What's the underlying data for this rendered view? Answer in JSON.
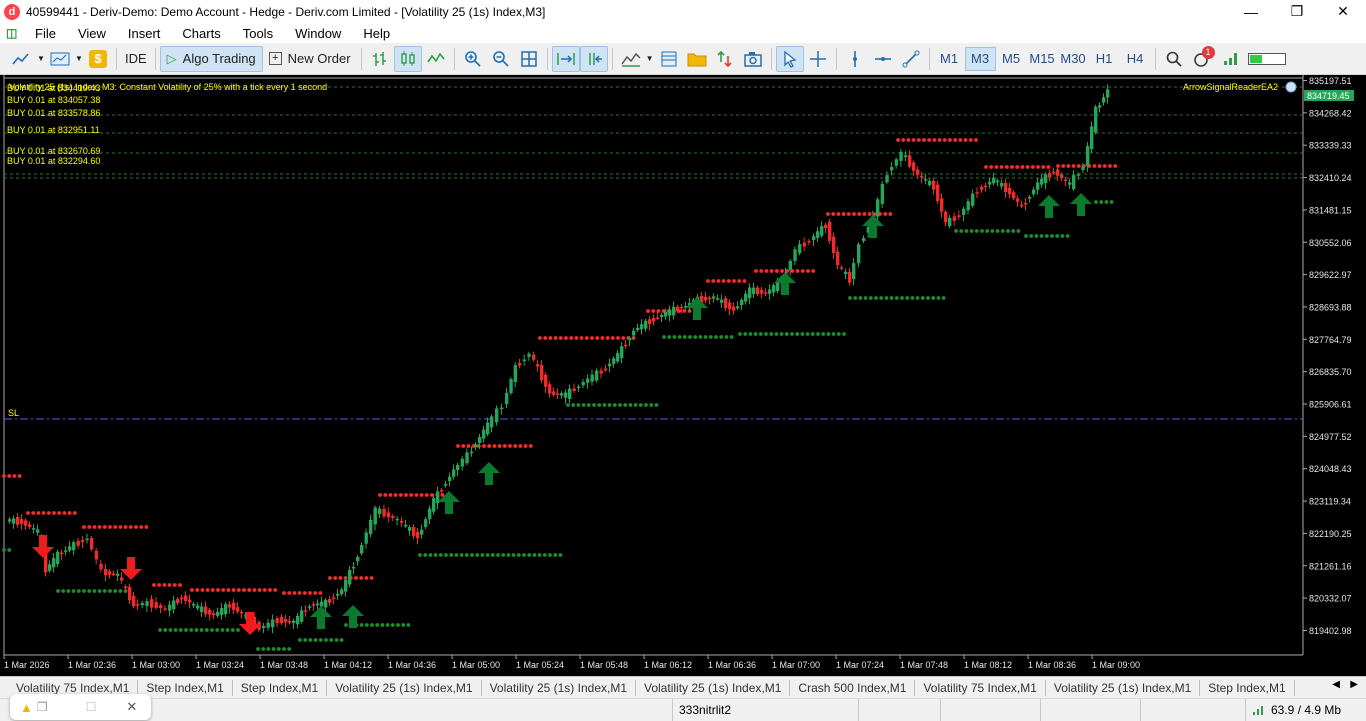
{
  "window": {
    "title": "40599441 - Deriv-Demo: Demo Account - Hedge - Deriv.com Limited - [Volatility 25 (1s) Index,M3]",
    "app_icon": "d",
    "minimize": "—",
    "restore": "❐",
    "close": "✕"
  },
  "menu": {
    "items": [
      "File",
      "View",
      "Insert",
      "Charts",
      "Tools",
      "Window",
      "Help"
    ]
  },
  "toolbar": {
    "ide": "IDE",
    "algo_trading": "Algo Trading",
    "new_order": "New Order",
    "timeframes": [
      "M1",
      "M3",
      "M5",
      "M15",
      "M30",
      "H1",
      "H4"
    ],
    "active_timeframe": "M3",
    "notifications_count": "1"
  },
  "chart": {
    "header": "Volatility 25 (1s) Index, M3:  Constant Volatility of 25% with a tick every 1 second",
    "indicator": "ArrowSignalReaderEA2",
    "bid_price": "834719.45",
    "sl_label": "SL",
    "buy_orders": [
      "BUY 0.01 at 834419.43",
      "BUY 0.01 at 834057.38",
      "BUY 0.01 at 833578.86",
      "BUY 0.01 at 832951.11",
      "BUY 0.01 at 832670.69",
      "BUY 0.01 at 832294.60"
    ],
    "price_axis": [
      "835197.51",
      "834268.42",
      "833339.33",
      "832410.24",
      "831481.15",
      "830552.06",
      "829622.97",
      "828693.88",
      "827764.79",
      "826835.70",
      "825906.61",
      "824977.52",
      "824048.43",
      "823119.34",
      "822190.25",
      "821261.16",
      "820332.07",
      "819402.98"
    ],
    "time_axis": [
      "1 Mar 2026",
      "1 Mar 02:36",
      "1 Mar 03:00",
      "1 Mar 03:24",
      "1 Mar 03:48",
      "1 Mar 04:12",
      "1 Mar 04:36",
      "1 Mar 05:00",
      "1 Mar 05:24",
      "1 Mar 05:48",
      "1 Mar 06:12",
      "1 Mar 06:36",
      "1 Mar 07:00",
      "1 Mar 07:24",
      "1 Mar 07:48",
      "1 Mar 08:12",
      "1 Mar 08:36",
      "1 Mar 09:00"
    ],
    "colors": {
      "bull": "#26a65b",
      "bear": "#ef2b2b",
      "buy_arrow": "#0c7a2c",
      "sell_arrow": "#ee1c1c",
      "resistance_dots": "#ff2a2a",
      "support_dots": "#1e8f2e",
      "order_text": "#ffff00",
      "sl_line": "#5b5bff"
    }
  },
  "chart_tabs": [
    "Volatility 75 Index,M1",
    "Step Index,M1",
    "Step Index,M1",
    "Volatility 25 (1s) Index,M1",
    "Volatility 25 (1s) Index,M1",
    "Volatility 25 (1s) Index,M1",
    "Crash 500 Index,M1",
    "Volatility 75 Index,M1",
    "Volatility 25 (1s) Index,M1",
    "Step Index,M1"
  ],
  "status": {
    "profile": "333nitrlit2",
    "traffic": "63.9 / 4.9 Mb",
    "notif_close": "✕"
  }
}
